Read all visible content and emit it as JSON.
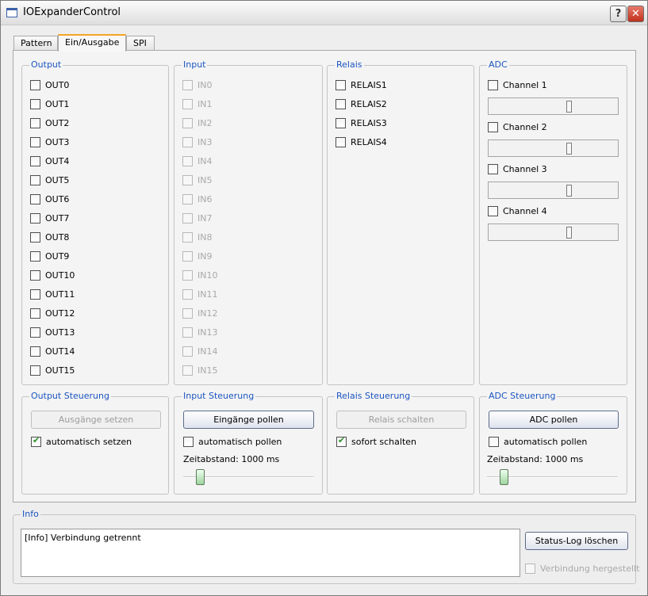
{
  "window": {
    "title": "IOExpanderControl",
    "help_label": "?",
    "close_label": "✕",
    "icon": "window-icon"
  },
  "tabs": [
    "Pattern",
    "Ein/Ausgabe",
    "SPI"
  ],
  "output": {
    "title": "Output",
    "items": [
      "OUT0",
      "OUT1",
      "OUT2",
      "OUT3",
      "OUT4",
      "OUT5",
      "OUT6",
      "OUT7",
      "OUT8",
      "OUT9",
      "OUT10",
      "OUT11",
      "OUT12",
      "OUT13",
      "OUT14",
      "OUT15"
    ]
  },
  "input": {
    "title": "Input",
    "items": [
      "IN0",
      "IN1",
      "IN2",
      "IN3",
      "IN4",
      "IN5",
      "IN6",
      "IN7",
      "IN8",
      "IN9",
      "IN10",
      "IN11",
      "IN12",
      "IN13",
      "IN14",
      "IN15"
    ]
  },
  "relais": {
    "title": "Relais",
    "items": [
      "RELAIS1",
      "RELAIS2",
      "RELAIS3",
      "RELAIS4"
    ]
  },
  "adc": {
    "title": "ADC",
    "channels": [
      "Channel 1",
      "Channel 2",
      "Channel 3",
      "Channel 4"
    ]
  },
  "output_steuerung": {
    "title": "Output Steuerung",
    "button": "Ausgänge setzen",
    "checkbox": "automatisch setzen",
    "checked": true
  },
  "input_steuerung": {
    "title": "Input Steuerung",
    "button": "Eingänge pollen",
    "checkbox": "automatisch pollen",
    "checked": false,
    "interval_label": "Zeitabstand: 1000 ms"
  },
  "relais_steuerung": {
    "title": "Relais Steuerung",
    "button": "Relais schalten",
    "checkbox": "sofort schalten",
    "checked": true
  },
  "adc_steuerung": {
    "title": "ADC Steuerung",
    "button": "ADC pollen",
    "checkbox": "automatisch pollen",
    "checked": false,
    "interval_label": "Zeitabstand: 1000 ms"
  },
  "info": {
    "title": "Info",
    "log": "[Info] Verbindung getrennt",
    "clear_button": "Status-Log löschen",
    "connected_label": "Verbindung hergestellt"
  }
}
